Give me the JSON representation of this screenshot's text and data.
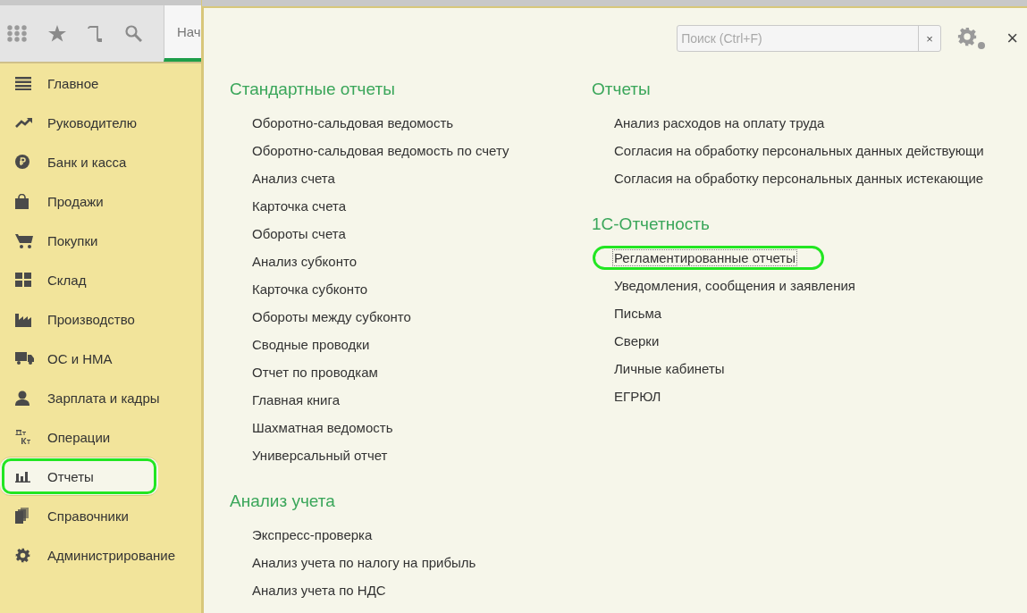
{
  "open_tab": {
    "label": "Нач",
    "selected": true
  },
  "sidebar": {
    "items": [
      {
        "label": "Главное",
        "kind": "list",
        "selected": false,
        "highlighted": false
      },
      {
        "label": "Руководителю",
        "kind": "trend",
        "selected": false,
        "highlighted": false
      },
      {
        "label": "Банк и касса",
        "kind": "coin",
        "selected": false,
        "highlighted": false
      },
      {
        "label": "Продажи",
        "kind": "bag",
        "selected": false,
        "highlighted": false
      },
      {
        "label": "Покупки",
        "kind": "cart",
        "selected": false,
        "highlighted": false
      },
      {
        "label": "Склад",
        "kind": "grid",
        "selected": false,
        "highlighted": false
      },
      {
        "label": "Производство",
        "kind": "factory",
        "selected": false,
        "highlighted": false
      },
      {
        "label": "ОС и НМА",
        "kind": "truck",
        "selected": false,
        "highlighted": false
      },
      {
        "label": "Зарплата и кадры",
        "kind": "person",
        "selected": false,
        "highlighted": false
      },
      {
        "label": "Операции",
        "kind": "dtkt",
        "selected": false,
        "highlighted": false
      },
      {
        "label": "Отчеты",
        "kind": "bars",
        "selected": true,
        "highlighted": true
      },
      {
        "label": "Справочники",
        "kind": "books",
        "selected": false,
        "highlighted": false
      },
      {
        "label": "Администрирование",
        "kind": "gear",
        "selected": false,
        "highlighted": false
      }
    ]
  },
  "panel": {
    "search": {
      "placeholder": "Поиск (Ctrl+F)",
      "clear_label": "×"
    },
    "close_label": "×",
    "columns": [
      [
        {
          "title": "Стандартные отчеты",
          "items": [
            {
              "label": "Оборотно-сальдовая ведомость",
              "focused": false,
              "highlighted": false
            },
            {
              "label": "Оборотно-сальдовая ведомость по счету",
              "focused": false,
              "highlighted": false
            },
            {
              "label": "Анализ счета",
              "focused": false,
              "highlighted": false
            },
            {
              "label": "Карточка счета",
              "focused": false,
              "highlighted": false
            },
            {
              "label": "Обороты счета",
              "focused": false,
              "highlighted": false
            },
            {
              "label": "Анализ субконто",
              "focused": false,
              "highlighted": false
            },
            {
              "label": "Карточка субконто",
              "focused": false,
              "highlighted": false
            },
            {
              "label": "Обороты между субконто",
              "focused": false,
              "highlighted": false
            },
            {
              "label": "Сводные проводки",
              "focused": false,
              "highlighted": false
            },
            {
              "label": "Отчет по проводкам",
              "focused": false,
              "highlighted": false
            },
            {
              "label": "Главная книга",
              "focused": false,
              "highlighted": false
            },
            {
              "label": "Шахматная ведомость",
              "focused": false,
              "highlighted": false
            },
            {
              "label": "Универсальный отчет",
              "focused": false,
              "highlighted": false
            }
          ]
        },
        {
          "title": "Анализ учета",
          "items": [
            {
              "label": "Экспресс-проверка",
              "focused": false,
              "highlighted": false
            },
            {
              "label": "Анализ учета по налогу на прибыль",
              "focused": false,
              "highlighted": false
            },
            {
              "label": "Анализ учета по НДС",
              "focused": false,
              "highlighted": false
            }
          ]
        }
      ],
      [
        {
          "title": "Отчеты",
          "items": [
            {
              "label": "Анализ расходов на оплату труда",
              "focused": false,
              "highlighted": false
            },
            {
              "label": "Согласия на обработку персональных данных действующи",
              "focused": false,
              "highlighted": false
            },
            {
              "label": "Согласия на обработку персональных данных истекающие",
              "focused": false,
              "highlighted": false
            }
          ]
        },
        {
          "title": "1С-Отчетность",
          "items": [
            {
              "label": "Регламентированные отчеты",
              "focused": true,
              "highlighted": true
            },
            {
              "label": "Уведомления, сообщения и заявления",
              "focused": false,
              "highlighted": false
            },
            {
              "label": "Письма",
              "focused": false,
              "highlighted": false
            },
            {
              "label": "Сверки",
              "focused": false,
              "highlighted": false
            },
            {
              "label": "Личные кабинеты",
              "focused": false,
              "highlighted": false
            },
            {
              "label": "ЕГРЮЛ",
              "focused": false,
              "highlighted": false
            }
          ]
        }
      ]
    ]
  }
}
